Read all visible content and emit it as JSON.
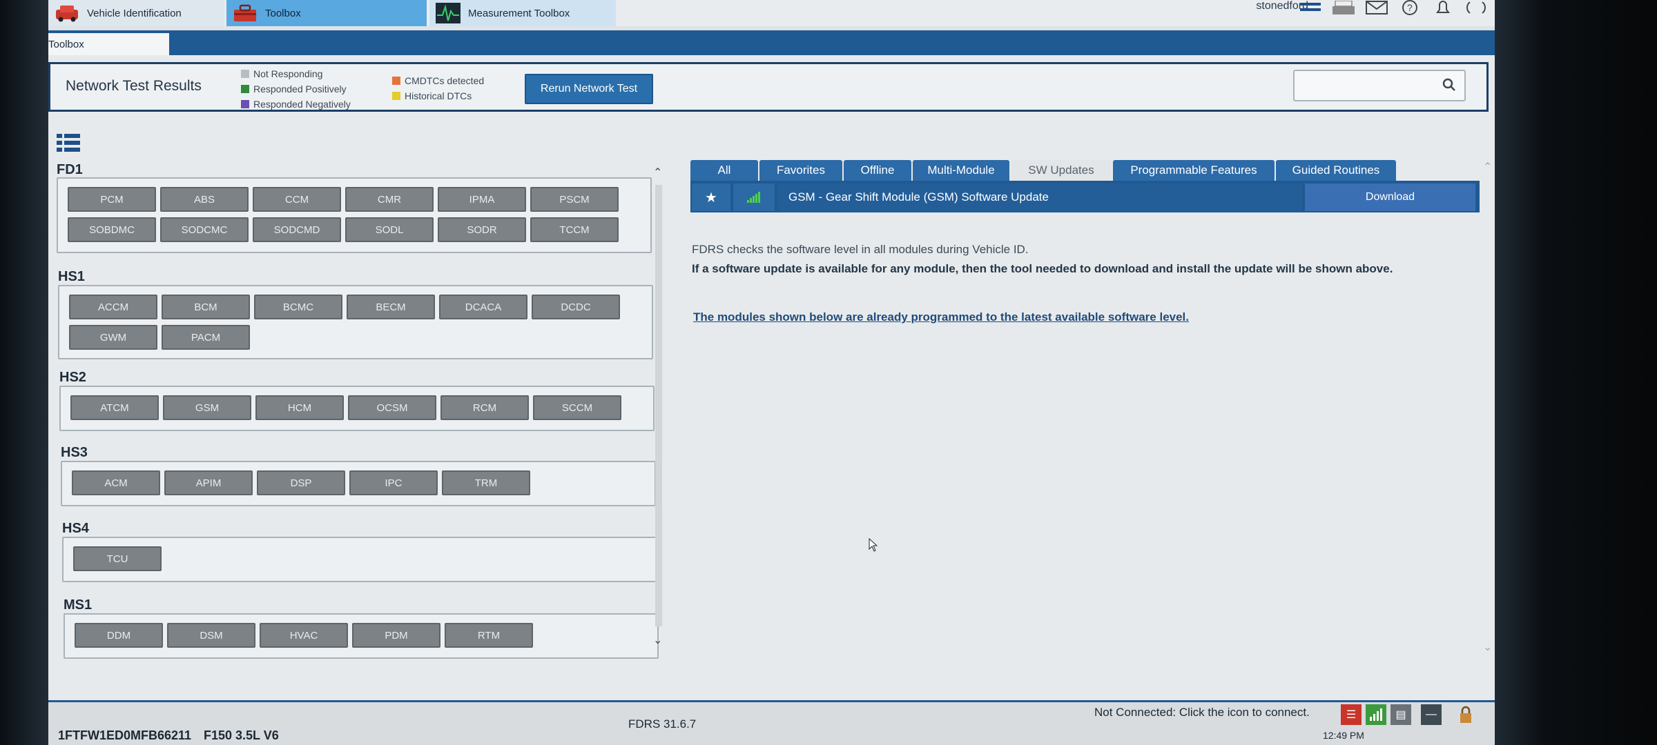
{
  "top_tabs": [
    {
      "label": "Vehicle Identification",
      "icon": "car-icon"
    },
    {
      "label": "Toolbox",
      "icon": "toolbox-icon"
    },
    {
      "label": "Measurement Toolbox",
      "icon": "waveform-icon"
    }
  ],
  "user": "stonedford",
  "top_icons": [
    "menu-icon",
    "printer-icon",
    "mail-icon",
    "help-icon",
    "bell-icon",
    "wireless-icon"
  ],
  "breadcrumb": "Toolbox",
  "network_test": {
    "title": "Network Test Results",
    "legend": [
      {
        "label": "Not Responding",
        "color": "#b9bdc0"
      },
      {
        "label": "Responded Positively",
        "color": "#2f8a3b"
      },
      {
        "label": "Responded Negatively",
        "color": "#6a4fb0"
      },
      {
        "label": "CMDTCs detected",
        "color": "#e6743a"
      },
      {
        "label": "Historical DTCs",
        "color": "#e3cc2b"
      }
    ],
    "rerun_label": "Rerun Network Test",
    "search_placeholder": ""
  },
  "groups": [
    {
      "name": "FD1",
      "modules": [
        "PCM",
        "ABS",
        "CCM",
        "CMR",
        "IPMA",
        "PSCM",
        "SOBDMC",
        "SODCMC",
        "SODCMD",
        "SODL",
        "SODR",
        "TCCM"
      ]
    },
    {
      "name": "HS1",
      "modules": [
        "ACCM",
        "BCM",
        "BCMC",
        "BECM",
        "DCACA",
        "DCDC",
        "GWM",
        "PACM"
      ]
    },
    {
      "name": "HS2",
      "modules": [
        "ATCM",
        "GSM",
        "HCM",
        "OCSM",
        "RCM",
        "SCCM"
      ]
    },
    {
      "name": "HS3",
      "modules": [
        "ACM",
        "APIM",
        "DSP",
        "IPC",
        "TRM"
      ]
    },
    {
      "name": "HS4",
      "modules": [
        "TCU"
      ]
    },
    {
      "name": "MS1",
      "modules": [
        "DDM",
        "DSM",
        "HVAC",
        "PDM",
        "RTM"
      ]
    }
  ],
  "right_tabs": [
    {
      "label": "All",
      "active": false
    },
    {
      "label": "Favorites",
      "active": false
    },
    {
      "label": "Offline",
      "active": false
    },
    {
      "label": "Multi-Module",
      "active": false
    },
    {
      "label": "SW Updates",
      "active": true
    },
    {
      "label": "Programmable Features",
      "active": false
    },
    {
      "label": "Guided Routines",
      "active": false
    }
  ],
  "sw_update": {
    "title": "GSM - Gear Shift Module (GSM) Software Update",
    "action": "Download"
  },
  "info": {
    "line1": "FDRS checks the software level in all modules during Vehicle ID.",
    "line2": "If a software update is available for any module, then the tool needed to download and install the update will be shown above.",
    "line3": "The modules shown below are already programmed to the latest available software level."
  },
  "status": {
    "vin": "1FTFW1ED0MFB66211",
    "vehicle": "F150 3.5L V6",
    "version": "FDRS 31.6.7",
    "connection": "Not Connected: Click the icon to connect.",
    "clock": "12:49 PM"
  }
}
